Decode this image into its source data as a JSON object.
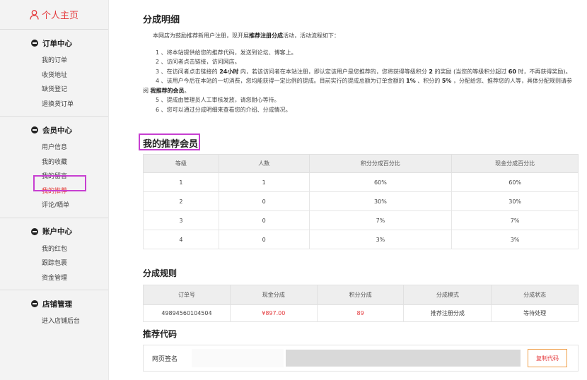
{
  "sidebar": {
    "profile_label": "个人主页",
    "groups": [
      {
        "title": "订单中心",
        "items": [
          "我的订单",
          "收货地址",
          "缺货登记",
          "退换货订单"
        ]
      },
      {
        "title": "会员中心",
        "items": [
          "用户信息",
          "我的收藏",
          "我的留言",
          "我的推荐",
          "评论/晒单"
        ]
      },
      {
        "title": "账户中心",
        "items": [
          "我的红包",
          "跟踪包裹",
          "资金管理"
        ]
      },
      {
        "title": "店铺管理",
        "items": [
          "进入店铺后台"
        ]
      }
    ],
    "active_item": "我的推荐"
  },
  "page_title": "分成明细",
  "intro": {
    "lead_pre": "本网店为鼓励推荐新用户注册，现开展",
    "lead_bold": "推荐注册分成",
    "lead_post": "活动，活动流程如下：",
    "line1": "1 、将本站提供给您的推荐代码，发送到论坛、博客上。",
    "line2": "2 、访问者点击链接，访问网店。",
    "line3_pre": "3 、在访问者点击链接的 ",
    "line3_bold1": "24小时",
    "line3_mid": " 内，若该访问者在本站注册，即认定该用户是您推荐的，您将获得等级积分 ",
    "line3_bold2": "2",
    "line3_mid2": " 的奖励 (当您的等级积分超过 ",
    "line3_bold3": "60",
    "line3_post": " 时，不再获得奖励)。",
    "line4_pre": "4 、该用户今后在本站的一切消费，您均能获得一定比例的提成。目前实行的提成总额为订单金额的 ",
    "line4_bold1": "1%",
    "line4_mid": " 、积分的 ",
    "line4_bold2": "5%",
    "line4_post": " ，分配给您、推荐您的人等，具体分配规则请参",
    "line4b_pre": "阅 ",
    "line4b_bold": "我推荐的会员",
    "line4b_post": "。",
    "line5": "5 、提成由管理员人工审核发放，请您耐心等待。",
    "line6": "6 、您可以通过分成明细来查看您的介绍、分成情况。"
  },
  "members": {
    "title": "我的推荐会员",
    "headers": [
      "等级",
      "人数",
      "积分分成百分比",
      "现金分成百分比"
    ],
    "rows": [
      [
        "1",
        "1",
        "60%",
        "60%"
      ],
      [
        "2",
        "0",
        "30%",
        "30%"
      ],
      [
        "3",
        "0",
        "7%",
        "7%"
      ],
      [
        "4",
        "0",
        "3%",
        "3%"
      ]
    ]
  },
  "rules": {
    "title": "分成规则",
    "headers": [
      "订单号",
      "现金分成",
      "积分分成",
      "分成模式",
      "分成状态"
    ],
    "row": {
      "order_no": "49894560104504",
      "cash": "¥897.00",
      "points": "89",
      "mode": "推荐注册分成",
      "status": "等待处理"
    }
  },
  "referral": {
    "title": "推荐代码",
    "label": "网页签名",
    "copy_label": "复制代码"
  },
  "colors": {
    "accent": "#e4393c",
    "highlight": "#c73fd1",
    "header_bg": "#eeeeee"
  }
}
